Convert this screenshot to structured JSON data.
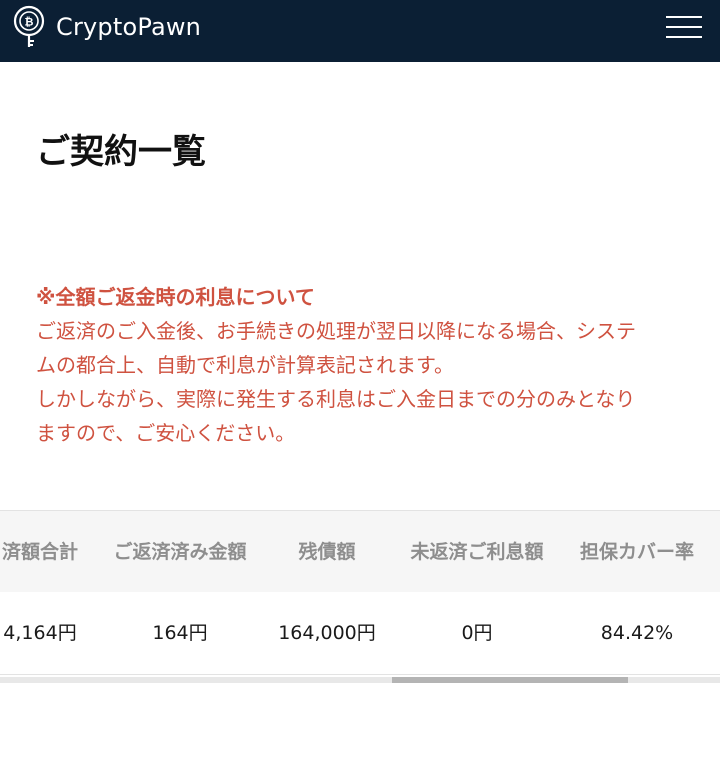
{
  "header": {
    "brand": "CryptoPawn",
    "menu_label": "menu"
  },
  "page": {
    "title": "ご契約一覧"
  },
  "notice": {
    "heading": "※全額ご返金時の利息について",
    "lines": [
      "ご返済のご入金後、お手続きの処理が翌日以降になる場合、システ",
      "ムの都合上、自動で利息が計算表記されます。",
      "しかしながら、実際に発生する利息はご入金日までの分のみとなり",
      "ますので、ご安心ください。"
    ]
  },
  "table": {
    "columns": [
      "済額合計",
      "ご返済済み金額",
      "残債額",
      "未返済ご利息額",
      "担保カバー率"
    ],
    "rows": [
      [
        "4,164円",
        "164円",
        "164,000円",
        "0円",
        "84.42%"
      ]
    ]
  },
  "scrollbar": {
    "position_fraction": 0.54,
    "visible_fraction": 0.33
  },
  "colors": {
    "header_bg": "#0b1f34",
    "notice_text": "#cf5240",
    "table_header_bg": "#f6f6f6"
  },
  "icons": {
    "logo": "bitcoin-key-icon",
    "menu": "hamburger-menu-icon"
  }
}
